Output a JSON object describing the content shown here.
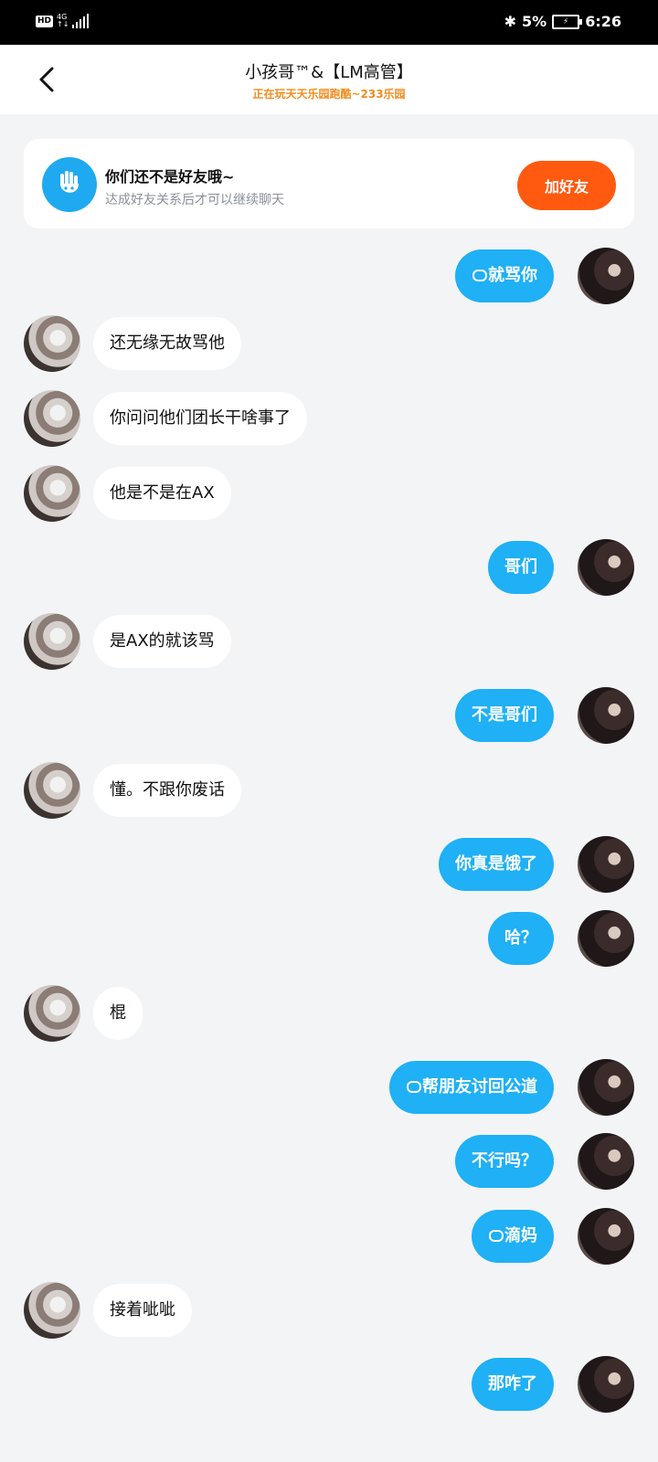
{
  "status_bar": {
    "hd": "HD",
    "network": "4G",
    "battery_percent": "5%",
    "time": "6:26"
  },
  "header": {
    "title": "小孩哥™&【LM高管】",
    "subtitle": "正在玩天天乐园跑酷~233乐园"
  },
  "banner": {
    "title": "你们还不是好友哦~",
    "subtitle": "达成好友关系后才可以继续聊天",
    "button_label": "加好友",
    "accent_color": "#FF5A10"
  },
  "messages": [
    {
      "side": "right",
      "text": "就骂你",
      "mask": true
    },
    {
      "side": "left",
      "text": "还无缘无故骂他",
      "mask": true
    },
    {
      "side": "left",
      "text": "你问问他们团长干啥事了"
    },
    {
      "side": "left",
      "text": "他是不是在AX"
    },
    {
      "side": "right",
      "text": "哥们"
    },
    {
      "side": "left",
      "text": "是AX的就该骂"
    },
    {
      "side": "right",
      "text": "不是哥们"
    },
    {
      "side": "left",
      "text": "懂。不跟你废话"
    },
    {
      "side": "right",
      "text": "你真是饿了"
    },
    {
      "side": "right",
      "text": "哈？"
    },
    {
      "side": "left",
      "text": "棍"
    },
    {
      "side": "right",
      "text": "帮朋友讨回公道",
      "mask": true
    },
    {
      "side": "right",
      "text": "不行吗？"
    },
    {
      "side": "right",
      "text": "滴妈",
      "mask": true
    },
    {
      "side": "left",
      "text": "接着呲呲"
    },
    {
      "side": "right",
      "text": "那咋了"
    }
  ],
  "colors": {
    "outgoing_bubble": "#1FB0F5",
    "incoming_bubble": "#FFFFFF",
    "background": "#F3F4F6",
    "subtitle": "#F08C1E"
  }
}
